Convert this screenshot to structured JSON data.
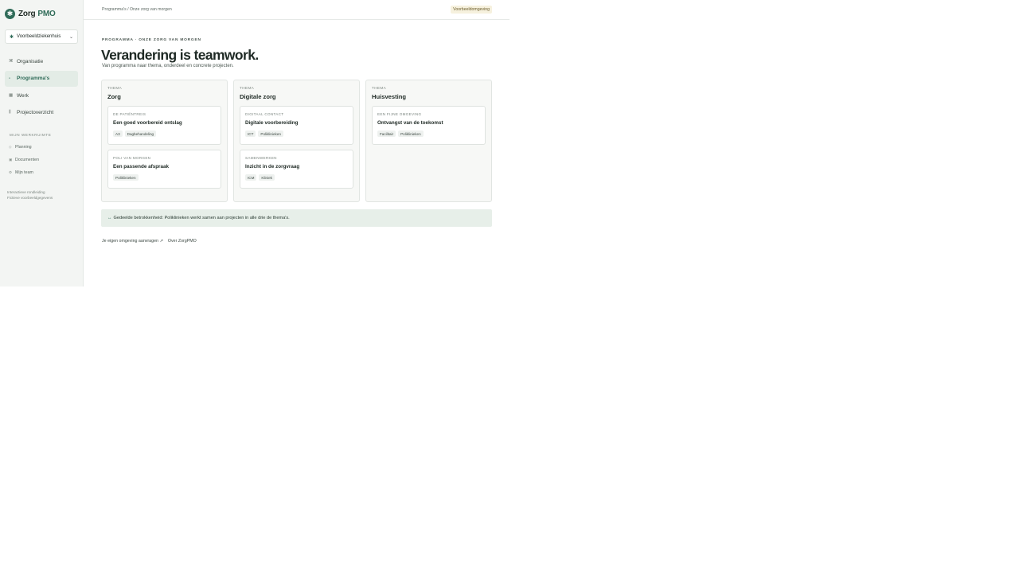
{
  "brand": {
    "mark": "✱",
    "name": "Zorg",
    "sub": "PMO"
  },
  "org_select": {
    "value": "Voorbeeldziekenhuis"
  },
  "nav": [
    {
      "icon": "network-icon",
      "glyph": "⌘",
      "label": "Organisatie",
      "active": false
    },
    {
      "icon": "grid-icon",
      "glyph": "▫",
      "label": "Programma's",
      "active": true
    },
    {
      "icon": "list-icon",
      "glyph": "▦",
      "label": "Werk",
      "active": false
    },
    {
      "icon": "bars-icon",
      "glyph": "⫼",
      "label": "Projectoverzicht",
      "active": false
    }
  ],
  "workspace": {
    "heading": "MIJN WERKRUIMTE",
    "items": [
      {
        "glyph": "◇",
        "label": "Planning"
      },
      {
        "glyph": "▣",
        "label": "Documenten"
      },
      {
        "glyph": "⚙",
        "label": "Mijn team"
      }
    ]
  },
  "footer": {
    "line1": "Interactieve rondleiding",
    "line2": "Fictieve voorbeeldgegevens"
  },
  "topbar": {
    "breadcrumb": "Programma's / Onze zorg van morgen",
    "env_badge": "Voorbeeldomgeving"
  },
  "hero": {
    "eyebrow": "PROGRAMMA · ONZE ZORG VAN MORGEN",
    "title": "Verandering is teamwork.",
    "subtitle": "Van programma naar thema, onderdeel en concrete projecten."
  },
  "themes": [
    {
      "kicker": "THEMA",
      "title": "Zorg",
      "cards": [
        {
          "kicker": "DE PATIËNTREIS",
          "title": "Een goed voorbereid ontslag",
          "tags": [
            "A3",
            "Dagbehandeling"
          ]
        },
        {
          "kicker": "POLI VAN MORGEN",
          "title": "Een passende afspraak",
          "tags": [
            "Poliklinieken"
          ]
        }
      ]
    },
    {
      "kicker": "THEMA",
      "title": "Digitale zorg",
      "cards": [
        {
          "kicker": "DIGITAAL CONTACT",
          "title": "Digitale voorbereiding",
          "tags": [
            "ICT",
            "Poliklinieken"
          ]
        },
        {
          "kicker": "SAMENWERKEN",
          "title": "Inzicht in de zorgvraag",
          "tags": [
            "ICM",
            "Kliniek"
          ]
        }
      ]
    },
    {
      "kicker": "THEMA",
      "title": "Huisvesting",
      "cards": [
        {
          "kicker": "EEN FIJNE OMGEVING",
          "title": "Ontvangst van de toekomst",
          "tags": [
            "Facilitair",
            "Poliklinieken"
          ]
        }
      ]
    }
  ],
  "shared_note": {
    "icon": "↔",
    "text": "Gedeelde betrokkenheid: Poliklinieken werkt samen aan projecten in alle drie de thema's."
  },
  "links": [
    "Je eigen omgeving aanvragen ↗",
    "Over ZorgPMO"
  ],
  "colors": {
    "accent": "#2f6b58",
    "sidebar_bg": "#f3f5f3",
    "note_bg": "#e7efe9",
    "badge_bg": "#f6f1de"
  }
}
